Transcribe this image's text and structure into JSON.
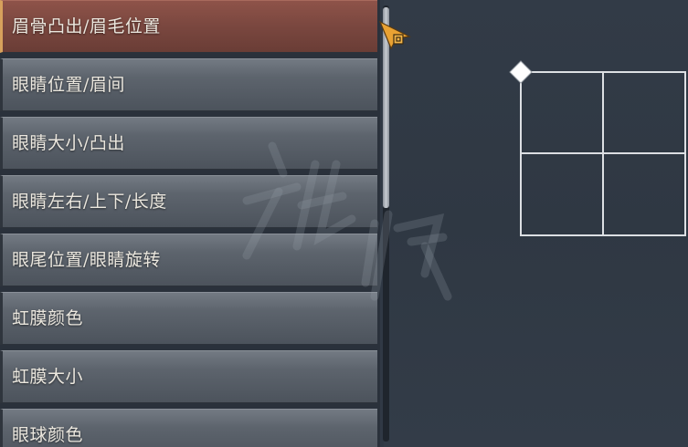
{
  "menu": {
    "items": [
      {
        "label": "眉骨凸出/眉毛位置",
        "selected": true
      },
      {
        "label": "眼睛位置/眉间",
        "selected": false
      },
      {
        "label": "眼睛大小/凸出",
        "selected": false
      },
      {
        "label": "眼睛左右/上下/长度",
        "selected": false
      },
      {
        "label": "眼尾位置/眼睛旋转",
        "selected": false
      },
      {
        "label": "虹膜颜色",
        "selected": false
      },
      {
        "label": "虹膜大小",
        "selected": false
      },
      {
        "label": "眼球颜色",
        "selected": false
      }
    ]
  },
  "colors": {
    "selected_item": "#7a473f",
    "selected_accent": "#d7a15c",
    "item_background": "#5d646d",
    "background": "#303945",
    "cursor": "#e9a233",
    "grid_lines": "#dcdfe3"
  },
  "icons": {
    "cursor": "arrow-cursor-icon",
    "grid_handle": "diamond-handle-icon"
  },
  "scrollbar": {
    "position_fraction": 0.0,
    "visible_fraction": 0.46
  }
}
